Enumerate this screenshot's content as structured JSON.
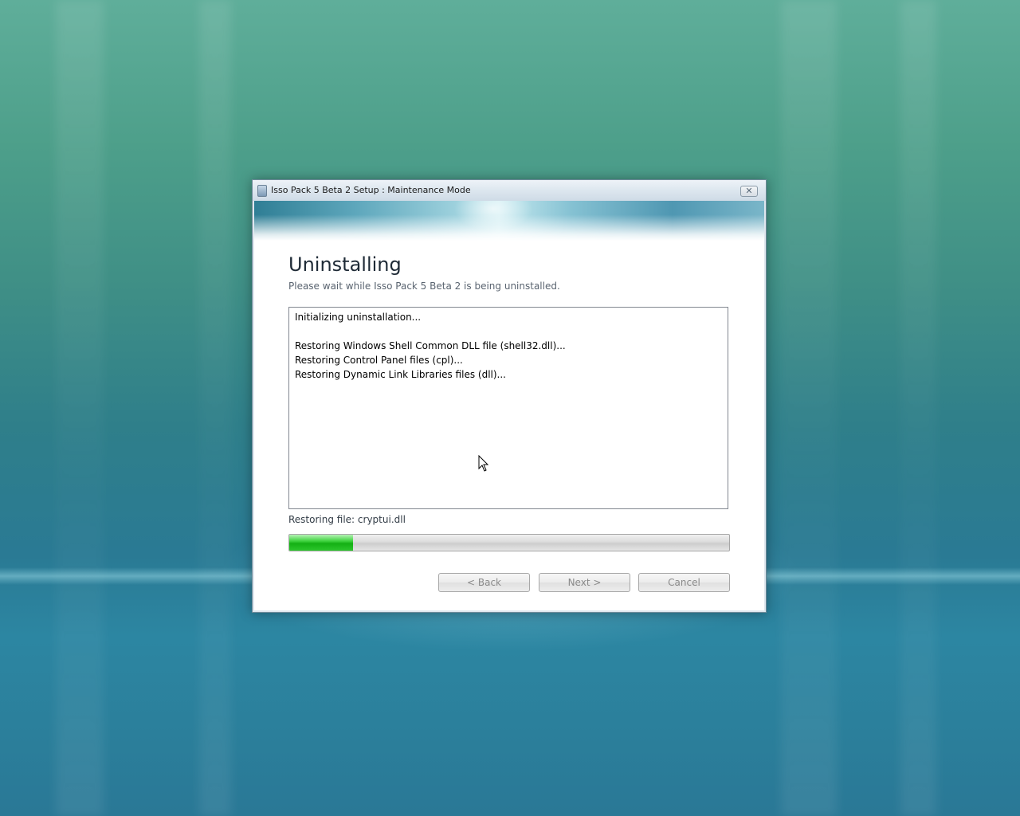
{
  "window": {
    "title": "Isso Pack 5 Beta 2 Setup : Maintenance Mode",
    "close_glyph": "✕"
  },
  "page": {
    "heading": "Uninstalling",
    "subtitle": "Please wait while Isso Pack 5 Beta 2 is being uninstalled."
  },
  "log": {
    "lines": [
      "Initializing uninstallation...",
      "",
      "Restoring Windows Shell Common DLL file (shell32.dll)...",
      "Restoring Control Panel files (cpl)...",
      "Restoring Dynamic Link Libraries files (dll)..."
    ]
  },
  "status": {
    "text": "Restoring file: cryptui.dll",
    "progress_percent": 14.5
  },
  "buttons": {
    "back": "< Back",
    "next": "Next >",
    "cancel": "Cancel"
  },
  "icons": {
    "app": "setup-app-icon",
    "close": "close-icon",
    "cursor": "mouse-pointer-icon"
  },
  "colors": {
    "progress_green": "#14b014",
    "desktop_teal": "#2a7a94"
  }
}
